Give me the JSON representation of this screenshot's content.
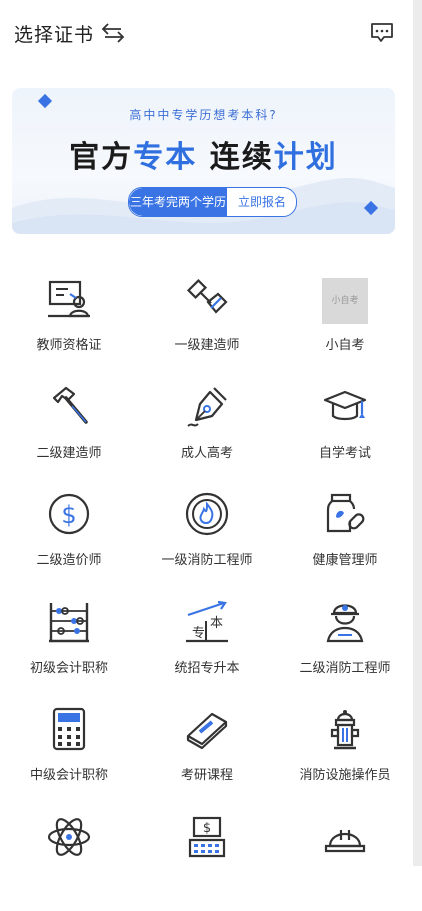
{
  "header": {
    "title": "选择证书",
    "swap_icon": "swap-arrows-icon",
    "message_icon": "message-icon"
  },
  "banner": {
    "subtitle": "高中中专学历想考本科?",
    "headline_black1": "官方",
    "headline_blue1": "专本",
    "headline_black2": "连续",
    "headline_blue2": "计划",
    "pill_left": "三年考完两个学历",
    "pill_right": "立即报名",
    "accent_color": "#2f6fe0"
  },
  "grid": [
    {
      "label": "教师资格证",
      "icon": "teacher-board-icon"
    },
    {
      "label": "一级建造师",
      "icon": "trowel-icon"
    },
    {
      "label": "小自考",
      "icon": "image-placeholder"
    },
    {
      "label": "二级建造师",
      "icon": "hammer-icon"
    },
    {
      "label": "成人高考",
      "icon": "pen-nib-icon"
    },
    {
      "label": "自学考试",
      "icon": "graduation-cap-icon"
    },
    {
      "label": "二级造价师",
      "icon": "dollar-coin-icon"
    },
    {
      "label": "一级消防工程师",
      "icon": "fire-icon"
    },
    {
      "label": "健康管理师",
      "icon": "medicine-bottle-icon"
    },
    {
      "label": "初级会计职称",
      "icon": "abacus-icon"
    },
    {
      "label": "统招专升本",
      "icon": "upgrade-chart-icon"
    },
    {
      "label": "二级消防工程师",
      "icon": "firefighter-icon"
    },
    {
      "label": "中级会计职称",
      "icon": "calculator-icon"
    },
    {
      "label": "考研课程",
      "icon": "book-icon"
    },
    {
      "label": "消防设施操作员",
      "icon": "fire-hydrant-icon"
    },
    {
      "label": "",
      "icon": "atom-icon"
    },
    {
      "label": "",
      "icon": "cash-register-icon"
    },
    {
      "label": "",
      "icon": "hard-hat-icon"
    }
  ],
  "placeholder_text": "小自考"
}
